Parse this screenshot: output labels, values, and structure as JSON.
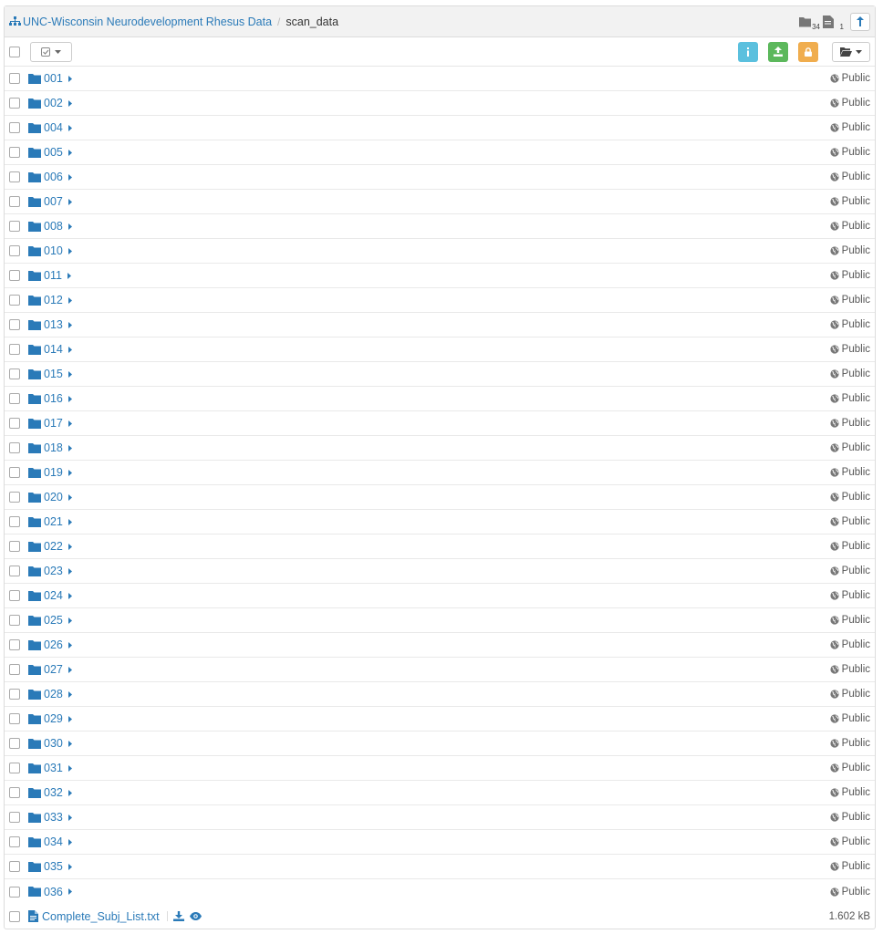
{
  "breadcrumb": {
    "collection": "UNC-Wisconsin Neurodevelopment Rhesus Data",
    "separator": "/",
    "current": "scan_data"
  },
  "header_counts": {
    "folders": "34",
    "items": "1"
  },
  "colors": {
    "link": "#2a7ab8",
    "info": "#5bc0de",
    "upload": "#5cb85c",
    "lock": "#f0ad4e"
  },
  "folders": [
    {
      "name": "001",
      "visibility": "Public"
    },
    {
      "name": "002",
      "visibility": "Public"
    },
    {
      "name": "004",
      "visibility": "Public"
    },
    {
      "name": "005",
      "visibility": "Public"
    },
    {
      "name": "006",
      "visibility": "Public"
    },
    {
      "name": "007",
      "visibility": "Public"
    },
    {
      "name": "008",
      "visibility": "Public"
    },
    {
      "name": "010",
      "visibility": "Public"
    },
    {
      "name": "011",
      "visibility": "Public"
    },
    {
      "name": "012",
      "visibility": "Public"
    },
    {
      "name": "013",
      "visibility": "Public"
    },
    {
      "name": "014",
      "visibility": "Public"
    },
    {
      "name": "015",
      "visibility": "Public"
    },
    {
      "name": "016",
      "visibility": "Public"
    },
    {
      "name": "017",
      "visibility": "Public"
    },
    {
      "name": "018",
      "visibility": "Public"
    },
    {
      "name": "019",
      "visibility": "Public"
    },
    {
      "name": "020",
      "visibility": "Public"
    },
    {
      "name": "021",
      "visibility": "Public"
    },
    {
      "name": "022",
      "visibility": "Public"
    },
    {
      "name": "023",
      "visibility": "Public"
    },
    {
      "name": "024",
      "visibility": "Public"
    },
    {
      "name": "025",
      "visibility": "Public"
    },
    {
      "name": "026",
      "visibility": "Public"
    },
    {
      "name": "027",
      "visibility": "Public"
    },
    {
      "name": "028",
      "visibility": "Public"
    },
    {
      "name": "029",
      "visibility": "Public"
    },
    {
      "name": "030",
      "visibility": "Public"
    },
    {
      "name": "031",
      "visibility": "Public"
    },
    {
      "name": "032",
      "visibility": "Public"
    },
    {
      "name": "033",
      "visibility": "Public"
    },
    {
      "name": "034",
      "visibility": "Public"
    },
    {
      "name": "035",
      "visibility": "Public"
    },
    {
      "name": "036",
      "visibility": "Public"
    }
  ],
  "file": {
    "name": "Complete_Subj_List.txt",
    "size": "1.602 kB"
  }
}
